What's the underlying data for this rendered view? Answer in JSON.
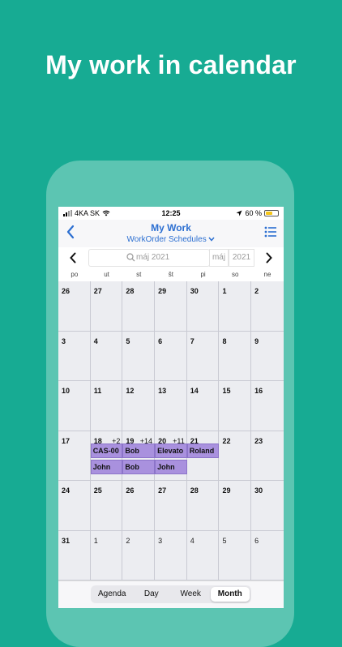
{
  "headline": "My work in calendar",
  "status": {
    "carrier": "4KA SK",
    "time": "12:25",
    "battery": "60 %",
    "battery_level": 0.6
  },
  "nav": {
    "title": "My Work",
    "subtitle": "WorkOrder Schedules"
  },
  "month_bar": {
    "search_placeholder": "máj 2021",
    "month": "máj",
    "year": "2021"
  },
  "weekdays": [
    "po",
    "ut",
    "st",
    "št",
    "pi",
    "so",
    "ne"
  ],
  "weeks": [
    [
      {
        "d": "26"
      },
      {
        "d": "27"
      },
      {
        "d": "28"
      },
      {
        "d": "29"
      },
      {
        "d": "30"
      },
      {
        "d": "1"
      },
      {
        "d": "2"
      }
    ],
    [
      {
        "d": "3"
      },
      {
        "d": "4"
      },
      {
        "d": "5"
      },
      {
        "d": "6"
      },
      {
        "d": "7"
      },
      {
        "d": "8"
      },
      {
        "d": "9"
      }
    ],
    [
      {
        "d": "10"
      },
      {
        "d": "11"
      },
      {
        "d": "12"
      },
      {
        "d": "13"
      },
      {
        "d": "14"
      },
      {
        "d": "15"
      },
      {
        "d": "16"
      }
    ],
    [
      {
        "d": "17"
      },
      {
        "d": "18",
        "more": "+2"
      },
      {
        "d": "19",
        "more": "+14"
      },
      {
        "d": "20",
        "more": "+11"
      },
      {
        "d": "21"
      },
      {
        "d": "22"
      },
      {
        "d": "23"
      }
    ],
    [
      {
        "d": "24"
      },
      {
        "d": "25"
      },
      {
        "d": "26"
      },
      {
        "d": "27"
      },
      {
        "d": "28"
      },
      {
        "d": "29"
      },
      {
        "d": "30"
      }
    ],
    [
      {
        "d": "31"
      },
      {
        "d": "1"
      },
      {
        "d": "2"
      },
      {
        "d": "3"
      },
      {
        "d": "4"
      },
      {
        "d": "5"
      },
      {
        "d": "6"
      }
    ]
  ],
  "events": {
    "e1": "CAS-00",
    "e2": "Bob",
    "e3": "Elevato",
    "e4": "Roland",
    "e5": "John",
    "e6": "Bob",
    "e7": "John"
  },
  "tabs": [
    "Agenda",
    "Day",
    "Week",
    "Month"
  ],
  "active_tab": "Month",
  "colors": {
    "background": "#17ab93",
    "accent": "#2c6fd1",
    "event": "#a991de"
  }
}
